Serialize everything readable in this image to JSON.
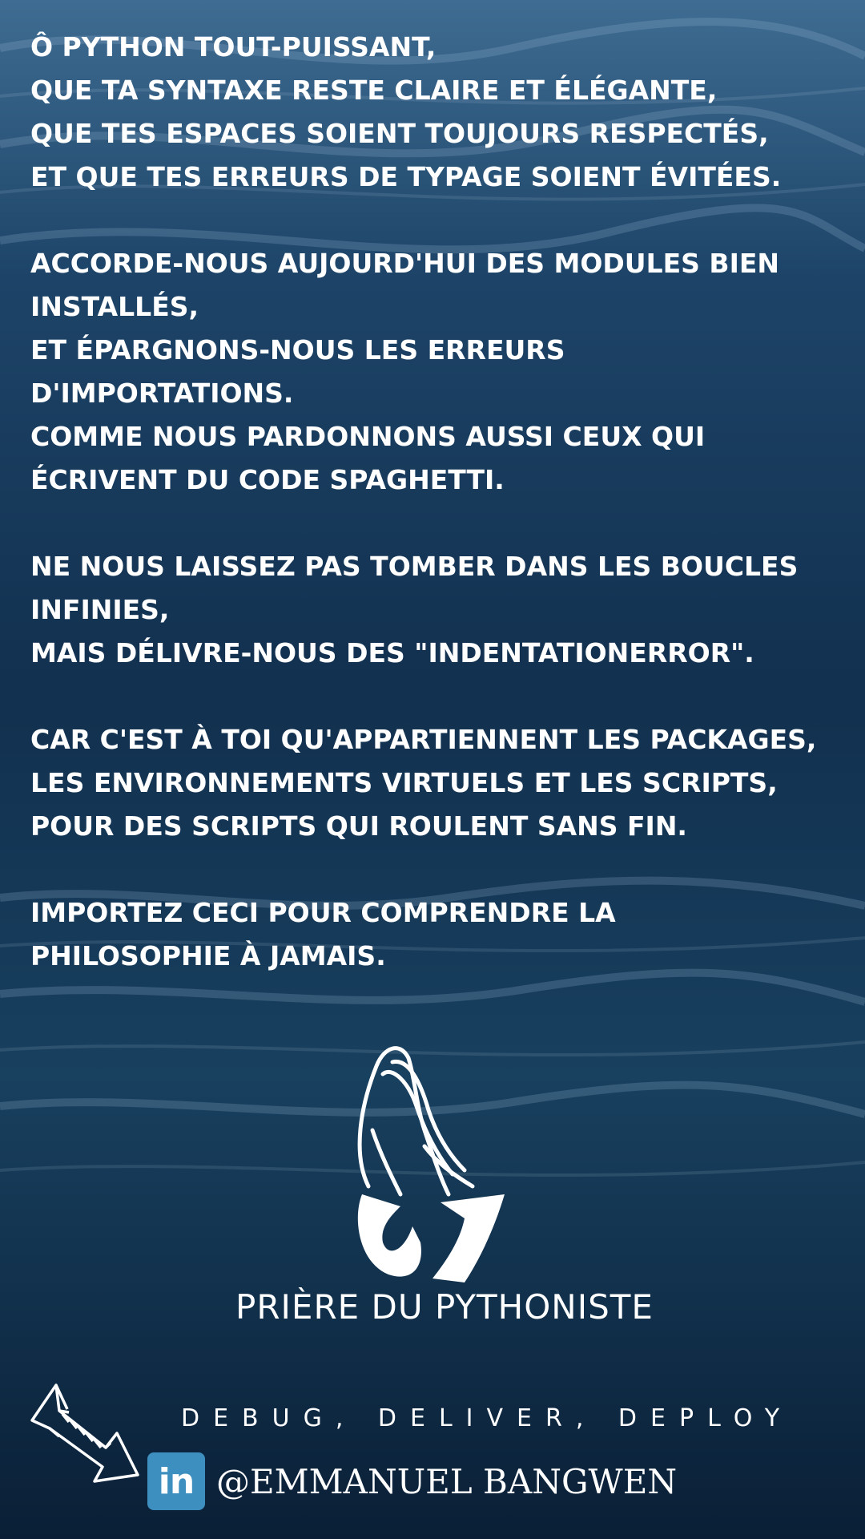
{
  "stanzas": [
    "Ô python tout-puissant,\nque ta syntaxe reste claire et élégante,\nque tes espaces soient toujours respectés,\net que tes erreurs de typage soient évitées.",
    "Accorde-nous aujourd'hui des modules bien\ninstallés,\net épargnons-nous les erreurs\nd'importations.\ncomme nous pardonnons aussi ceux qui\nécrivent du code spaghetti.",
    "Ne nous laissez pas tomber dans les boucles\ninfinies,\nmais délivre-nous des \"IndentationError\".",
    "Car c'est à toi qu'appartiennent les packages,\nles environnements virtuels et les scripts,\npour des scripts qui roulent sans fin.",
    "Importez ceci pour comprendre la\nphilosophie à jamais."
  ],
  "hands_icon": "praying-hands-icon",
  "title": "PRIÈRE DU PYTHONISTE",
  "tagline": "DEBUG, DELIVER, DEPLOY",
  "social": {
    "icon": "linkedin-icon",
    "icon_text": "in",
    "handle": "@EMMANUEL BANGWEN"
  },
  "arrow_icon": "arrow-down-right-icon",
  "colors": {
    "background_dark": "#0c2540",
    "background_light": "#3f6c92",
    "text": "#ffffff",
    "linkedin": "#3d8fbf"
  }
}
